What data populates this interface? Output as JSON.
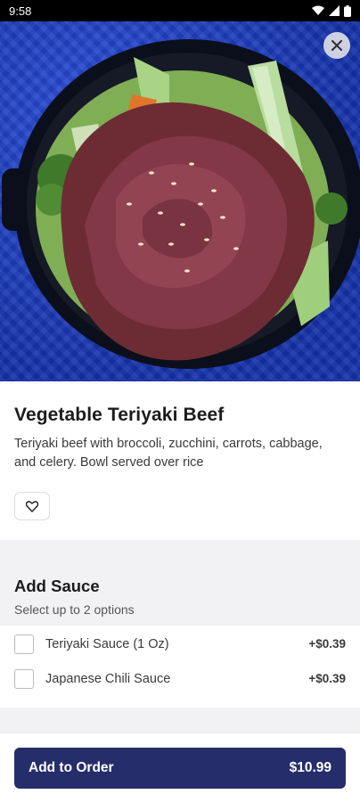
{
  "status_bar": {
    "time": "9:58",
    "icons": [
      "wifi-icon",
      "signal-icon",
      "battery-icon"
    ]
  },
  "hero": {
    "image": "teriyaki-beef-bowl-photo",
    "close_icon": "close-icon"
  },
  "item": {
    "title": "Vegetable Teriyaki Beef",
    "description": "Teriyaki beef with broccoli, zucchini, carrots, cabbage, and celery. Bowl served over rice",
    "favorite_icon": "heart-outline-icon"
  },
  "sauce": {
    "title": "Add Sauce",
    "subtitle": "Select up to 2 options",
    "options": [
      {
        "label": "Teriyaki Sauce (1 Oz)",
        "price": "+$0.39",
        "checked": false
      },
      {
        "label": "Japanese Chili Sauce",
        "price": "+$0.39",
        "checked": false
      }
    ]
  },
  "footer": {
    "button_label": "Add to Order",
    "total": "$10.99"
  },
  "colors": {
    "primary": "#252d6b",
    "hero_background": "#1f3fc4",
    "section_bg": "#f2f2f4"
  }
}
